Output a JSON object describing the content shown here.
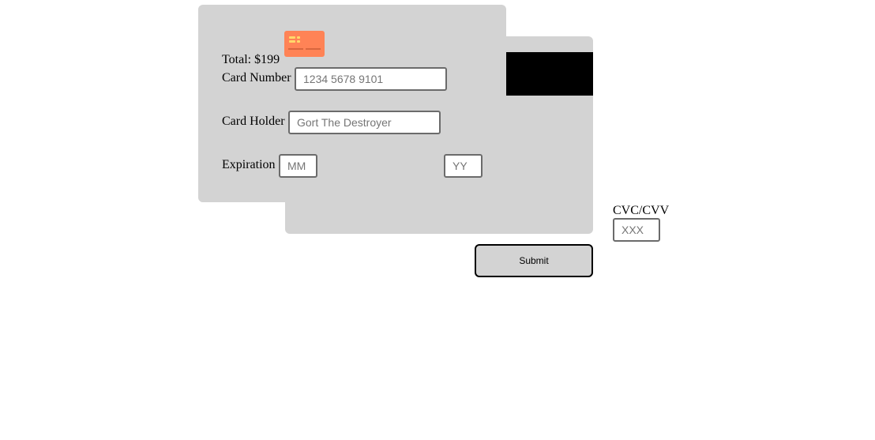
{
  "total": {
    "text": "Total: $199"
  },
  "card_number": {
    "label": "Card Number",
    "placeholder": "1234 5678 9101"
  },
  "card_holder": {
    "label": "Card Holder",
    "placeholder": "Gort The Destroyer"
  },
  "expiration": {
    "label": "Expiration",
    "month_placeholder": "MM",
    "year_placeholder": "YY"
  },
  "cvc": {
    "label": "CVC/CVV",
    "placeholder": "XXX"
  },
  "submit": {
    "label": "Submit"
  },
  "colors": {
    "card": "#d3d3d3",
    "stripe": "#000000",
    "logo": "#ff8356"
  },
  "icons": {
    "card_logo": "credit-card-icon"
  }
}
